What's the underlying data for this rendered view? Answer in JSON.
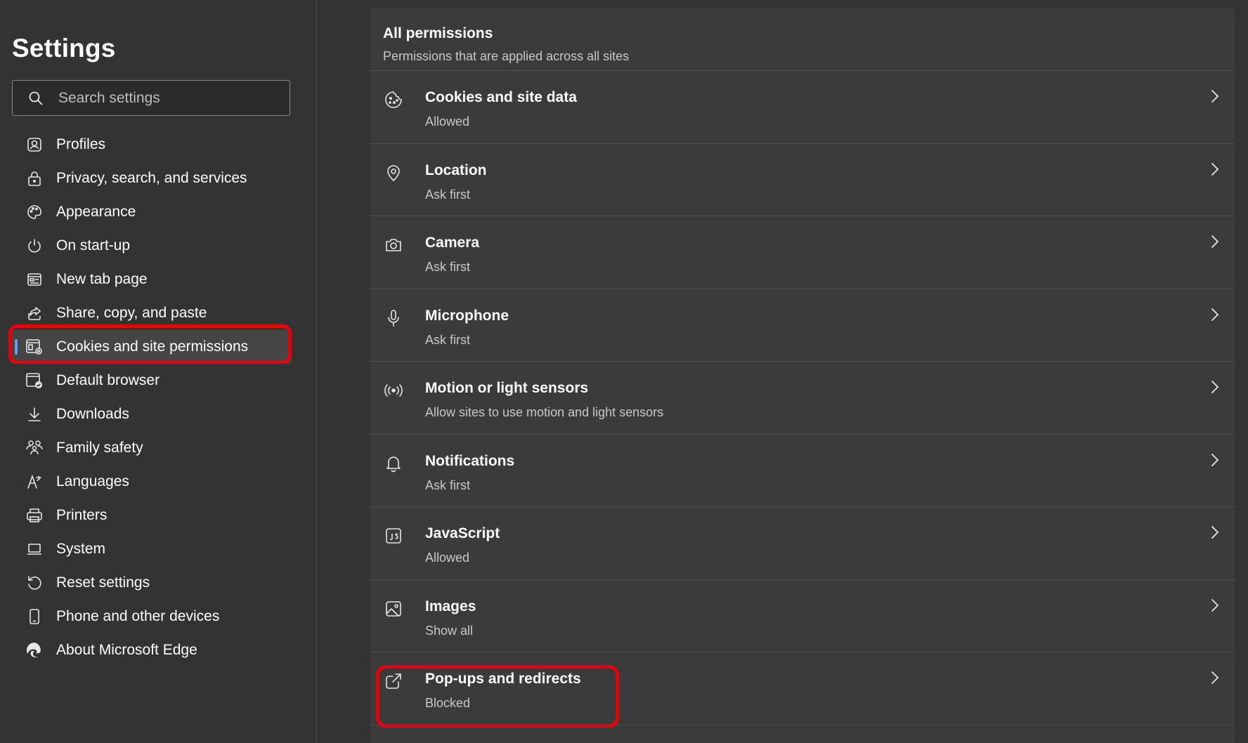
{
  "sidebar": {
    "title": "Settings",
    "search": {
      "placeholder": "Search settings"
    },
    "items": [
      {
        "label": "Profiles",
        "icon": "profile-icon"
      },
      {
        "label": "Privacy, search, and services",
        "icon": "lock-icon"
      },
      {
        "label": "Appearance",
        "icon": "palette-icon"
      },
      {
        "label": "On start-up",
        "icon": "power-icon"
      },
      {
        "label": "New tab page",
        "icon": "new-tab-icon"
      },
      {
        "label": "Share, copy, and paste",
        "icon": "share-icon"
      },
      {
        "label": "Cookies and site permissions",
        "icon": "site-permissions-icon",
        "active": true
      },
      {
        "label": "Default browser",
        "icon": "default-browser-icon"
      },
      {
        "label": "Downloads",
        "icon": "download-icon"
      },
      {
        "label": "Family safety",
        "icon": "family-icon"
      },
      {
        "label": "Languages",
        "icon": "languages-icon"
      },
      {
        "label": "Printers",
        "icon": "printer-icon"
      },
      {
        "label": "System",
        "icon": "laptop-icon"
      },
      {
        "label": "Reset settings",
        "icon": "reset-icon"
      },
      {
        "label": "Phone and other devices",
        "icon": "phone-icon"
      },
      {
        "label": "About Microsoft Edge",
        "icon": "edge-logo-icon"
      }
    ]
  },
  "main": {
    "section_title": "All permissions",
    "section_subtitle": "Permissions that are applied across all sites",
    "permissions": [
      {
        "name": "Cookies and site data",
        "status": "Allowed",
        "icon": "cookie-icon"
      },
      {
        "name": "Location",
        "status": "Ask first",
        "icon": "location-icon"
      },
      {
        "name": "Camera",
        "status": "Ask first",
        "icon": "camera-icon"
      },
      {
        "name": "Microphone",
        "status": "Ask first",
        "icon": "microphone-icon"
      },
      {
        "name": "Motion or light sensors",
        "status": "Allow sites to use motion and light sensors",
        "icon": "sensor-icon"
      },
      {
        "name": "Notifications",
        "status": "Ask first",
        "icon": "bell-icon"
      },
      {
        "name": "JavaScript",
        "status": "Allowed",
        "icon": "javascript-icon"
      },
      {
        "name": "Images",
        "status": "Show all",
        "icon": "image-icon"
      },
      {
        "name": "Pop-ups and redirects",
        "status": "Blocked",
        "icon": "popup-icon"
      }
    ]
  },
  "colors": {
    "background": "#333333",
    "panel": "#3b3b3b",
    "accent": "#60a0f0",
    "highlight": "#e8000b"
  }
}
